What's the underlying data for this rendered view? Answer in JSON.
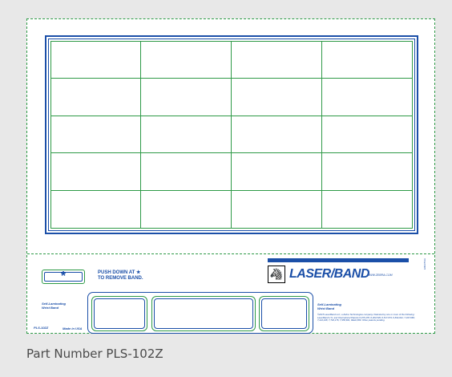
{
  "sheet": {
    "grid": {
      "rows": 5,
      "cols": 4
    },
    "stub": {
      "star": "*",
      "push_line1": "PUSH DOWN AT ★",
      "push_line2": "TO REMOVE BAND.",
      "brand_name": "LASER/BAND",
      "website": "WWW.ZEBRA.COM",
      "vertical_code": "E002703A",
      "left_label_line1": "Self-Laminating",
      "left_label_line2": "Wrist Band",
      "right_label_line1": "Self-Laminating",
      "right_label_line2": "Wrist Band",
      "part_small": "PLS-102Z",
      "made_in": "Made in USA",
      "legal": "©2015 LaserBand LLC, a Zebra Technologies company. Patented by one or more of the following: LaserBand U.S. and International Patents 6,155,476; 6,303,539; 6,517,974; 6,844,041; 7,047,669; 7,222,448; 7,740,176; 7,958,661; RE42,860. Other patents pending."
    }
  },
  "caption": "Part Number  PLS-102Z",
  "colors": {
    "green": "#2e9a47",
    "blue": "#1b4fa8",
    "background": "#e8e8e8"
  }
}
